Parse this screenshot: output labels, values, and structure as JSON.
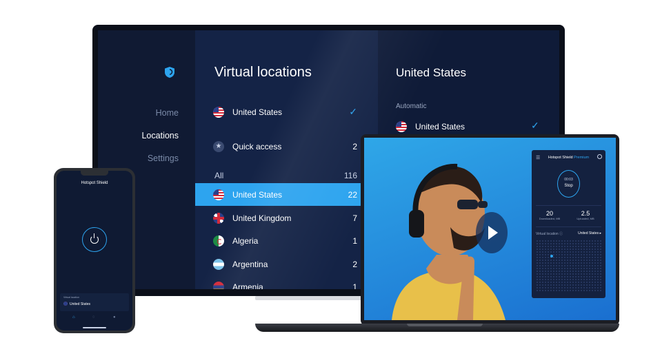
{
  "tv": {
    "nav": {
      "home": "Home",
      "locations": "Locations",
      "settings": "Settings"
    },
    "list": {
      "title": "Virtual locations",
      "current": {
        "name": "United States"
      },
      "quick_access": {
        "label": "Quick access",
        "count": "2"
      },
      "all": {
        "label": "All",
        "count": "116"
      },
      "items": [
        {
          "name": "United States",
          "count": "22"
        },
        {
          "name": "United Kingdom",
          "count": "7"
        },
        {
          "name": "Algeria",
          "count": "1"
        },
        {
          "name": "Argentina",
          "count": "2"
        },
        {
          "name": "Armenia",
          "count": "1"
        }
      ]
    },
    "detail": {
      "title": "United States",
      "automatic": "Automatic",
      "option": "United States"
    }
  },
  "laptop_app": {
    "brand": "Hotspot Shield",
    "tier": "Premium",
    "timer": "00:03",
    "stop": "Stop",
    "downloaded_value": "20",
    "downloaded_label": "Downloaded, MB",
    "uploaded_value": "2.5",
    "uploaded_label": "Uploaded, MB",
    "virtual_location_label": "Virtual location ⓘ",
    "virtual_location_value": "United States ▸"
  },
  "phone": {
    "title": "Hotspot Shield",
    "card_label": "Virtual location",
    "card_value": "United States"
  },
  "colors": {
    "accent": "#2da4ef",
    "navy": "#142346"
  }
}
